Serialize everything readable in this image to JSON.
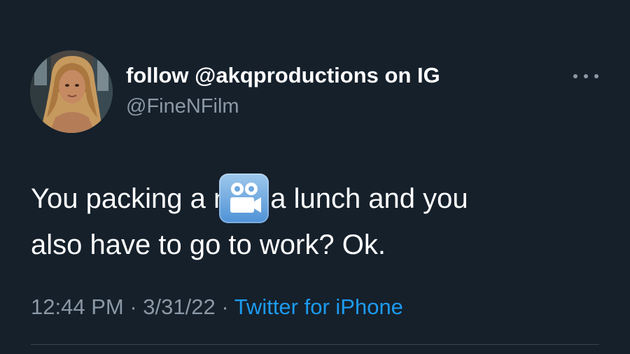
{
  "tweet": {
    "author": {
      "display_name": "follow @akqproductions on IG",
      "handle": "@FineNFilm",
      "avatar_icon": "profile-photo"
    },
    "more_icon": "more-horizontal-icon",
    "text": {
      "line1_before": "You packing a n",
      "emoji": "movie-camera-emoji",
      "line1_after": "a lunch and you",
      "line2": "also have to go to work? Ok."
    },
    "meta": {
      "time": "12:44 PM",
      "separator": " · ",
      "date": "3/31/22",
      "source": "Twitter for iPhone"
    }
  },
  "colors": {
    "background": "#15202b",
    "primary_text": "#ffffff",
    "secondary_text": "#8b98a5",
    "link": "#1d9bf0",
    "divider": "#38444d"
  }
}
